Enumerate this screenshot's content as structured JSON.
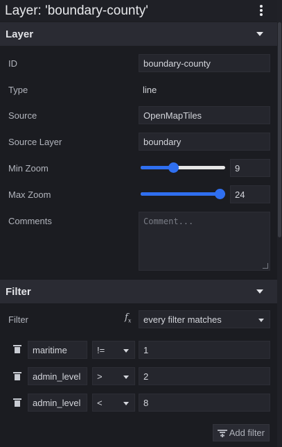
{
  "header": {
    "title": "Layer: 'boundary-county'",
    "menu_icon": "more-vertical-icon"
  },
  "layer_section": {
    "title": "Layer",
    "fields": {
      "id_label": "ID",
      "id_value": "boundary-county",
      "type_label": "Type",
      "type_value": "line",
      "source_label": "Source",
      "source_value": "OpenMapTiles",
      "source_layer_label": "Source Layer",
      "source_layer_value": "boundary",
      "min_zoom_label": "Min Zoom",
      "min_zoom_value": "9",
      "max_zoom_label": "Max Zoom",
      "max_zoom_value": "24",
      "comments_label": "Comments",
      "comments_placeholder": "Comment..."
    },
    "sliders": {
      "min_zoom_fraction": 0.375,
      "max_zoom_fraction": 1.0
    }
  },
  "filter_section": {
    "title": "Filter",
    "filter_label": "Filter",
    "fx_icon": "function-icon",
    "match_mode": "every filter matches",
    "rows": [
      {
        "key": "maritime",
        "op": "!=",
        "value": "1"
      },
      {
        "key": "admin_level",
        "op": ">",
        "value": "2"
      },
      {
        "key": "admin_level",
        "op": "<",
        "value": "8"
      }
    ],
    "add_filter_label": "Add filter"
  },
  "colors": {
    "accent": "#2f6ff0",
    "background": "#1b1c21",
    "section_header": "#2a2b33"
  }
}
